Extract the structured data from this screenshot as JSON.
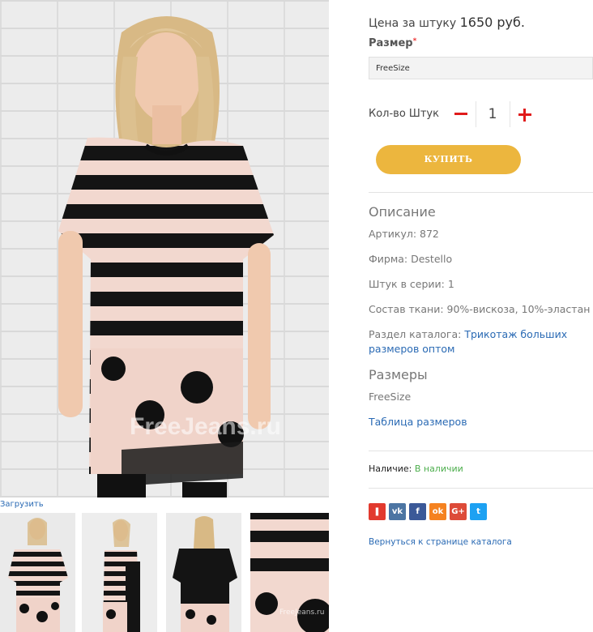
{
  "gallery": {
    "load_label": "Загрузить",
    "watermark": "FreeJeans.ru",
    "thumb_watermark": "FreeJeans.ru"
  },
  "product": {
    "price_prefix": "Цена за штуку",
    "price_value": "1650 руб.",
    "size_label": "Размер",
    "size_required_mark": "*",
    "size_selected": "FreeSize",
    "qty_label": "Кол-во Штук",
    "qty_value": "1",
    "buy_label": "КУПИТЬ"
  },
  "description": {
    "title": "Описание",
    "article": "Артикул: 872",
    "brand": "Фирма: Destello",
    "series": "Штук в серии: 1",
    "fabric": "Состав ткани: 90%-вискоза, 10%-эластан",
    "catalog_prefix": "Раздел каталога:",
    "catalog_link": "Трикотаж больших размеров оптом"
  },
  "sizes": {
    "title": "Размеры",
    "value": "FreeSize",
    "table_link": "Таблица размеров"
  },
  "availability": {
    "label": "Наличие:",
    "value": "В наличии"
  },
  "social": [
    {
      "name": "bookmark",
      "glyph": "❚",
      "color": "#e23a2e"
    },
    {
      "name": "vk",
      "glyph": "vk",
      "color": "#4c75a3"
    },
    {
      "name": "facebook",
      "glyph": "f",
      "color": "#3b5998"
    },
    {
      "name": "odnoklassniki",
      "glyph": "ok",
      "color": "#f58220"
    },
    {
      "name": "google-plus",
      "glyph": "G+",
      "color": "#dd4b39"
    },
    {
      "name": "twitter",
      "glyph": "t",
      "color": "#1da1f2"
    }
  ],
  "back_link": "Вернуться к странице каталога"
}
